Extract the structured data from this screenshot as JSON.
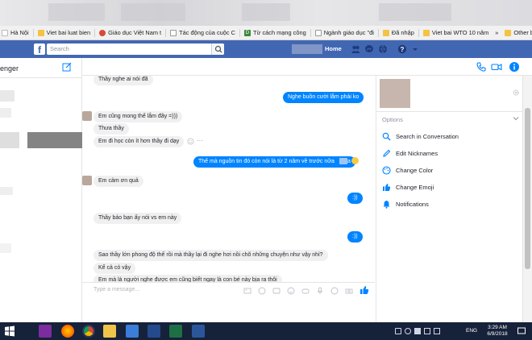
{
  "bookmarks": [
    {
      "label": "Hà Nội",
      "icon": "page-icon",
      "color": "#ffffff"
    },
    {
      "label": "Viet bai luat bien",
      "icon": "folder-icon",
      "color": "#f5c342"
    },
    {
      "label": "Giáo dục Việt Nam t",
      "icon": "site-icon",
      "color": "#d84a38"
    },
    {
      "label": "Tác động của cuộc C",
      "icon": "page-icon",
      "color": "#9e9e9e"
    },
    {
      "label": "Từ cách mạng công",
      "icon": "d-icon",
      "color": "#3a8a3a"
    },
    {
      "label": "Ngành giáo dục \"đi",
      "icon": "page-icon",
      "color": "#9e9e9e"
    },
    {
      "label": "Đã nhập",
      "icon": "folder-icon",
      "color": "#f5c342"
    },
    {
      "label": "Viet bai WTO 10 năm",
      "icon": "folder-icon",
      "color": "#f5c342"
    }
  ],
  "bookmarks_more": "»",
  "other_bookmarks": "Other bookmarks",
  "facebook": {
    "logo": "f",
    "search_placeholder": "Search",
    "home_label": "Home"
  },
  "sidebar": {
    "title": "enger"
  },
  "conversation": {
    "messages": [
      {
        "id": "m0",
        "dir": "in",
        "text": "Thầy nghe ai nói đã"
      },
      {
        "id": "m1",
        "dir": "out",
        "text": "Nghe buồn cười lắm phải ko"
      },
      {
        "id": "m2",
        "dir": "in",
        "text": "Em cũng mong thế lắm đây =)))"
      },
      {
        "id": "m3",
        "dir": "in",
        "text": "Thưa thầy"
      },
      {
        "id": "m4",
        "dir": "in",
        "text": "Em đi học còn ít hơn thầy đi dạy"
      },
      {
        "id": "m5",
        "dir": "out",
        "text": "Thế mà nguồn tin đó còn nói là từ 2 năm về trước nữa"
      },
      {
        "id": "m6",
        "dir": "in",
        "text": "Em cảm ơn quả"
      },
      {
        "id": "m7",
        "dir": "out",
        "text": ":))"
      },
      {
        "id": "m8",
        "dir": "in",
        "text": "Thầy bảo bạn ấy nói vs em này"
      },
      {
        "id": "m9",
        "dir": "out",
        "text": ":))"
      },
      {
        "id": "m10",
        "dir": "in",
        "text": "Sao thầy lớn phong độ thế rồi mà thầy lại đi nghe hơi nồi chõ những chuyện như vậy nhỉ?"
      },
      {
        "id": "m11",
        "dir": "in",
        "text": "Kể cả có vậy"
      },
      {
        "id": "m12",
        "dir": "in",
        "text": "Em mà là người nghe được em cũng biết ngay là con bé này bịa ra thôi"
      }
    ],
    "more_dots": "···",
    "emoji_suffix": "a"
  },
  "composer": {
    "placeholder": "Type a message..."
  },
  "info_panel": {
    "options_label": "Options",
    "items": [
      {
        "label": "Search in Conversation",
        "icon": "search-icon"
      },
      {
        "label": "Edit Nicknames",
        "icon": "pencil-icon"
      },
      {
        "label": "Change Color",
        "icon": "palette-icon"
      },
      {
        "label": "Change Emoji",
        "icon": "thumbs-up-icon"
      },
      {
        "label": "Notifications",
        "icon": "bell-icon"
      }
    ]
  },
  "taskbar": {
    "apps": [
      "start-icon",
      "onenote-icon",
      "firefox-icon",
      "chrome-icon",
      "explorer-icon",
      "photos-icon",
      "video-icon",
      "excel-icon",
      "word-icon"
    ],
    "language": "ENG",
    "time": "3:29 AM",
    "date": "6/9/2018"
  },
  "colors": {
    "facebook_blue": "#4267b2",
    "messenger_blue": "#0084ff",
    "taskbar": "#16213a"
  }
}
